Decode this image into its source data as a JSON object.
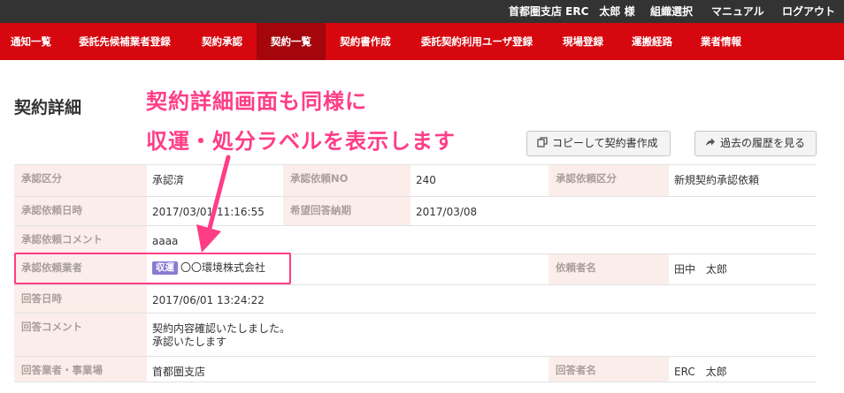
{
  "header": {
    "user": "首都圏支店 ERC　太郎 様",
    "org_select": "組織選択",
    "manual": "マニュアル",
    "logout": "ログアウト"
  },
  "nav": {
    "tabs": [
      {
        "label": "通知一覧",
        "active": false
      },
      {
        "label": "委託先候補業者登録",
        "active": false
      },
      {
        "label": "契約承認",
        "active": false
      },
      {
        "label": "契約一覧",
        "active": true
      },
      {
        "label": "契約書作成",
        "active": false
      },
      {
        "label": "委託契約利用ユーザ登録",
        "active": false
      },
      {
        "label": "現場登録",
        "active": false
      },
      {
        "label": "運搬経路",
        "active": false
      },
      {
        "label": "業者情報",
        "active": false
      }
    ]
  },
  "page": {
    "title": "契約詳細",
    "copy_button": "コピーして契約書作成",
    "history_button": "過去の履歴を見る"
  },
  "annotation": {
    "line1": "契約詳細画面も同様に",
    "line2": "収運・処分ラベルを表示します",
    "color": "#ff3d86"
  },
  "detail": {
    "approval_status_label": "承認区分",
    "approval_status": "承認済",
    "request_no_label": "承認依頼NO",
    "request_no": "240",
    "request_type_label": "承認依頼区分",
    "request_type": "新規契約承認依頼",
    "request_datetime_label": "承認依頼日時",
    "request_datetime": "2017/03/01 11:16:55",
    "desired_reply_label": "希望回答納期",
    "desired_reply": "2017/03/08",
    "request_comment_label": "承認依頼コメント",
    "request_comment": "aaaa",
    "request_vendor_label": "承認依頼業者",
    "vendor_badge": "収運",
    "vendor_name": "〇〇環境株式会社",
    "requester_label": "依頼者名",
    "requester": "田中　太郎",
    "reply_datetime_label": "回答日時",
    "reply_datetime": "2017/06/01 13:24:22",
    "reply_comment_label": "回答コメント",
    "reply_comment_line1": "契約内容確認いたしました。",
    "reply_comment_line2": "承認いたします",
    "reply_office_label": "回答業者・事業場",
    "reply_office": "首都圏支店",
    "replier_label": "回答者名",
    "replier": "ERC　太郎"
  },
  "colors": {
    "nav_red": "#d7070f",
    "nav_active": "#a4060c",
    "topbar": "#333333",
    "label_bg": "#fbeeea",
    "badge": "#8a7ad0"
  }
}
